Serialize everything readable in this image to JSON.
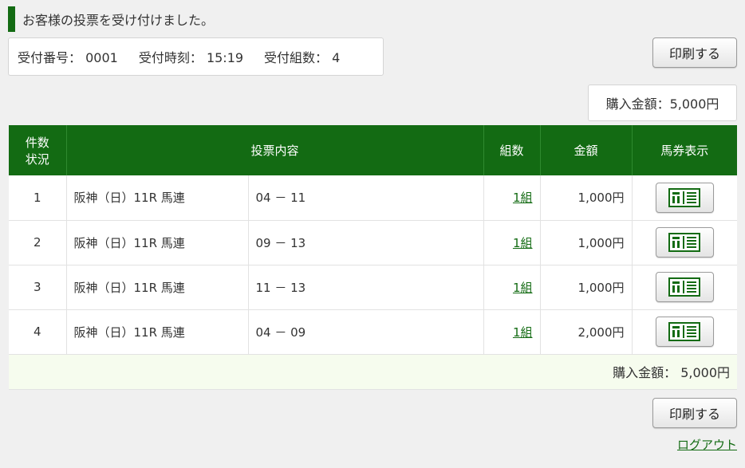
{
  "notice": {
    "message": "お客様の投票を受け付けました。",
    "accent_color": "#136b13"
  },
  "receipt": {
    "number_label": "受付番号：",
    "number": "0001",
    "time_label": "受付時刻：",
    "time": "15:19",
    "count_label": "受付組数：",
    "count": "4"
  },
  "actions": {
    "print_label": "印刷する",
    "logout_label": "ログアウト"
  },
  "total": {
    "label": "購入金額：",
    "value": "5,000円"
  },
  "table": {
    "headers": {
      "no_line1": "件数",
      "no_line2": "状況",
      "content": "投票内容",
      "kumi": "組数",
      "amount": "金額",
      "ticket": "馬券表示"
    },
    "rows": [
      {
        "no": "1",
        "race": "阪神（日）11R 馬連",
        "numbers": "04 － 11",
        "kumi": "1組",
        "amount": "1,000円",
        "ticket_icon": "ticket-icon"
      },
      {
        "no": "2",
        "race": "阪神（日）11R 馬連",
        "numbers": "09 － 13",
        "kumi": "1組",
        "amount": "1,000円",
        "ticket_icon": "ticket-icon"
      },
      {
        "no": "3",
        "race": "阪神（日）11R 馬連",
        "numbers": "11 － 13",
        "kumi": "1組",
        "amount": "1,000円",
        "ticket_icon": "ticket-icon"
      },
      {
        "no": "4",
        "race": "阪神（日）11R 馬連",
        "numbers": "04 － 09",
        "kumi": "1組",
        "amount": "2,000円",
        "ticket_icon": "ticket-icon"
      }
    ],
    "footer": {
      "label": "購入金額：",
      "value": "5,000円"
    }
  }
}
